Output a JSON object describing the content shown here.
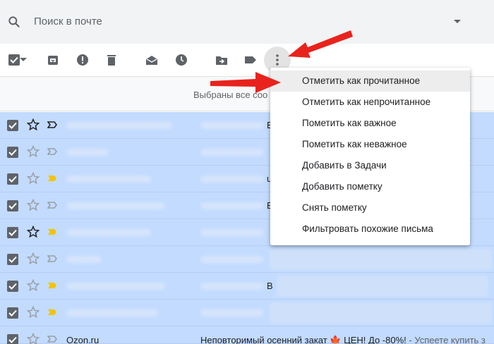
{
  "search": {
    "placeholder": "Поиск в почте"
  },
  "toolbar": {
    "icons": [
      "select-all-checkbox",
      "archive-icon",
      "report-spam-icon",
      "delete-icon",
      "mark-read-icon",
      "snooze-icon",
      "move-to-icon",
      "label-icon",
      "more-options-icon"
    ]
  },
  "banner": {
    "text": "Выбраны все соо"
  },
  "menu": {
    "items": [
      "Отметить как прочитанное",
      "Отметить как непрочитанное",
      "Пометить как важное",
      "Пометить как неважное",
      "Добавить в Задачи",
      "Добавить пометку",
      "Снять пометку",
      "Фильтровать похожие письма"
    ]
  },
  "rows": [
    {
      "sender": "",
      "subject": ""
    },
    {
      "sender": "",
      "subject": ""
    },
    {
      "sender": "",
      "subject": ""
    },
    {
      "sender": "",
      "subject": ""
    },
    {
      "sender": "",
      "subject": ""
    },
    {
      "sender": "",
      "subject": ""
    },
    {
      "sender": "",
      "subject": ""
    },
    {
      "sender": "",
      "subject": ""
    },
    {
      "sender": "Ozon.ru",
      "subject": "Неповторимый осенний закат 🍁 ЦЕН! До -80%!",
      "snippet": " - Успеете купить з"
    }
  ],
  "colors": {
    "selected_row": "#c2dbff",
    "arrow": "#e8231d",
    "important_marker": "#f2c400"
  }
}
